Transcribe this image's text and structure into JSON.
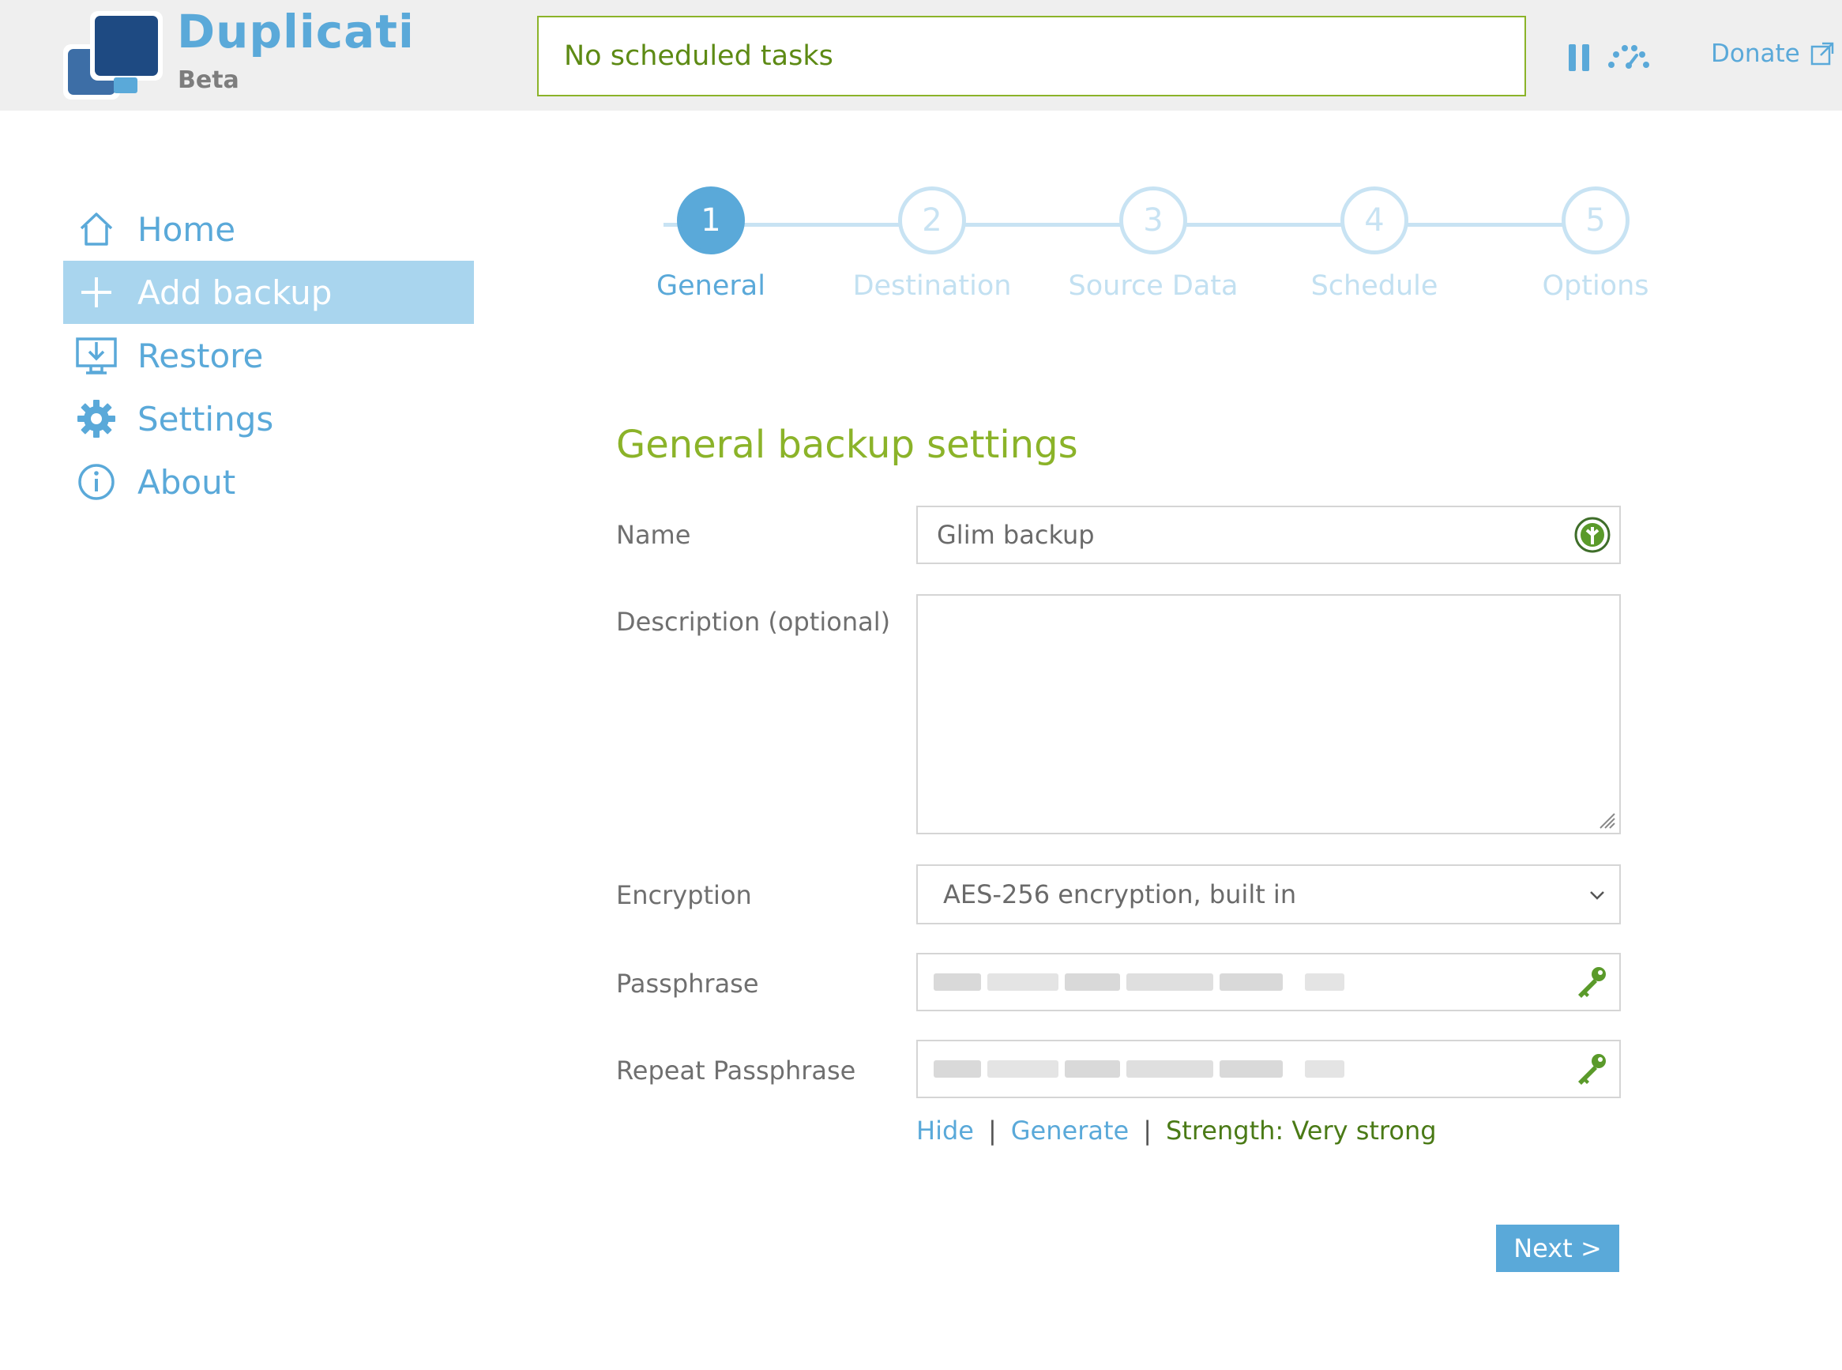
{
  "brand": {
    "name": "Duplicati",
    "subtitle": "Beta"
  },
  "status": {
    "text": "No scheduled tasks"
  },
  "header": {
    "donate_label": "Donate"
  },
  "sidebar": {
    "items": [
      {
        "label": "Home",
        "icon": "home-icon"
      },
      {
        "label": "Add backup",
        "icon": "plus-icon",
        "active": true
      },
      {
        "label": "Restore",
        "icon": "restore-icon"
      },
      {
        "label": "Settings",
        "icon": "gear-icon"
      },
      {
        "label": "About",
        "icon": "info-icon"
      }
    ]
  },
  "steps": [
    {
      "number": "1",
      "label": "General",
      "active": true
    },
    {
      "number": "2",
      "label": "Destination"
    },
    {
      "number": "3",
      "label": "Source Data"
    },
    {
      "number": "4",
      "label": "Schedule"
    },
    {
      "number": "5",
      "label": "Options"
    }
  ],
  "form": {
    "title": "General backup settings",
    "name_label": "Name",
    "name_value": "Glim backup",
    "description_label": "Description (optional)",
    "description_value": "",
    "encryption_label": "Encryption",
    "encryption_value": "AES-256 encryption, built in",
    "passphrase_label": "Passphrase",
    "repeat_label": "Repeat Passphrase",
    "hide_link": "Hide",
    "generate_link": "Generate",
    "separator": "|",
    "strength_text": "Strength: Very strong"
  },
  "actions": {
    "next_label": "Next >"
  },
  "colors": {
    "accent": "#5aa9d9",
    "green": "#8bb329",
    "active_nav_bg": "#a9d5ee",
    "inactive_step": "#c8e3f3",
    "key_icon": "#5a9a2a"
  }
}
